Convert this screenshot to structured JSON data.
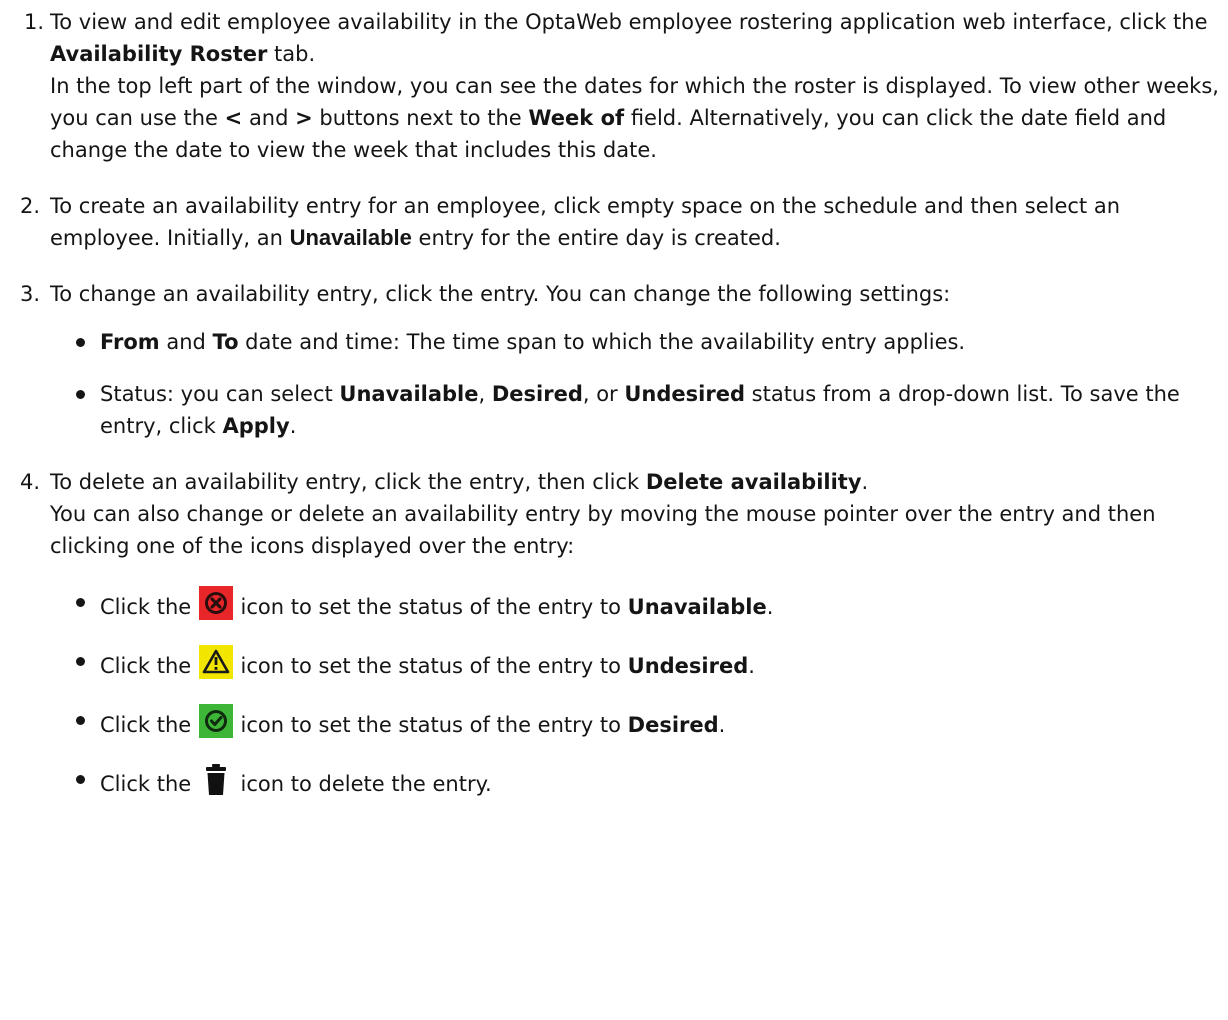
{
  "steps": [
    {
      "num": "1.",
      "line1_a": "To view and edit employee availability in the OptaWeb employee rostering application web interface, click the ",
      "line1_b": "Availability Roster",
      "line1_c": " tab.",
      "line2_a": "In the top left part of the window, you can see the dates for which the roster is displayed. To view other weeks, you can use the ",
      "prev_button": "<",
      "line2_b": " and ",
      "next_button": ">",
      "line2_c": " buttons next to the ",
      "line2_d": "Week of",
      "line2_e": " field. Alternatively, you can click the date field and change the date to view the week that includes this date."
    },
    {
      "num": "2.",
      "text_a": "To create an availability entry for an employee, click empty space on the schedule and then select an employee. Initially, an ",
      "text_b": "Unavailable",
      "text_c": " entry for the entire day is created."
    },
    {
      "num": "3.",
      "text": "To change an availability entry, click the entry. You can change the following settings:",
      "bullets": [
        {
          "a": "From",
          "b": " and ",
          "c": "To",
          "d": " date and time: The time span to which the availability entry applies."
        },
        {
          "a": "Status: you can select ",
          "b": "Unavailable",
          "c": ", ",
          "d": "Desired",
          "e": ", or ",
          "f": "Undesired",
          "g": " status from a drop-down list. To save the entry, click ",
          "h": "Apply",
          "i": "."
        }
      ]
    },
    {
      "num": "4.",
      "text_a": "To delete an availability entry, click the entry, then click ",
      "text_b": "Delete availability",
      "text_c": ".",
      "text_d": "You can also change or delete an availability entry by moving the mouse pointer over the entry and then clicking one of the icons displayed over the entry:",
      "icon_bullets": [
        {
          "before": "Click the ",
          "icon": "unavailable-icon",
          "color": "#e8262a",
          "after": " icon to set the status of the entry to ",
          "status": "Unavailable",
          "end": "."
        },
        {
          "before": "Click the ",
          "icon": "undesired-icon",
          "color": "#f2e600",
          "after": " icon to set the status of the entry to ",
          "status": "Undesired",
          "end": "."
        },
        {
          "before": "Click the ",
          "icon": "desired-icon",
          "color": "#3db537",
          "after": " icon to set the status of the entry to ",
          "status": "Desired",
          "end": "."
        },
        {
          "before": "Click the ",
          "icon": "trash-icon",
          "color": "#111111",
          "after": " icon to delete the entry."
        }
      ]
    }
  ]
}
